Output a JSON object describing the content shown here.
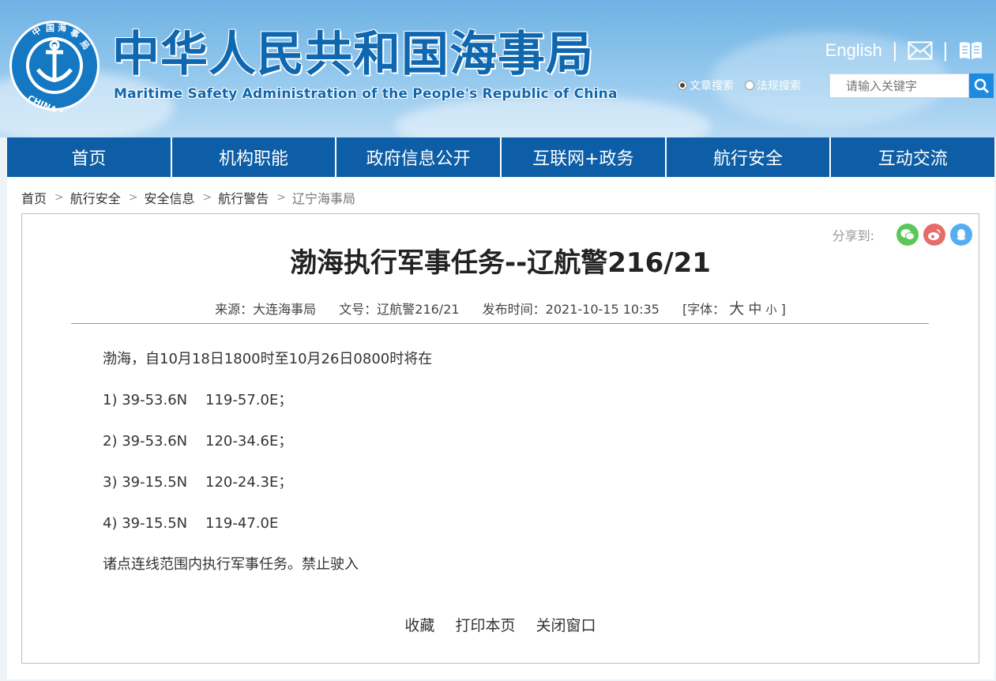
{
  "header": {
    "title": "中华人民共和国海事局",
    "subtitle": "Maritime Safety Administration of the People's Republic of China",
    "logo_text": "中国海事局 CHINA MSA",
    "english_link": "English",
    "search_options": [
      "文章搜索",
      "法规搜索"
    ],
    "search_selected": "文章搜索",
    "search_placeholder": "请输入关键字"
  },
  "nav": {
    "items": [
      "首页",
      "机构职能",
      "政府信息公开",
      "互联网+政务",
      "航行安全",
      "互动交流"
    ]
  },
  "breadcrumb": [
    "首页",
    "航行安全",
    "安全信息",
    "航行警告",
    "辽宁海事局"
  ],
  "share": {
    "label": "分享到:",
    "targets": [
      "wechat-icon",
      "weibo-icon",
      "qq-icon"
    ]
  },
  "article": {
    "title": "渤海执行军事任务--辽航警216/21",
    "source": "来源：大连海事局",
    "doc_no": "文号：辽航警216/21",
    "published": "发布时间：2021-10-15 10:35",
    "font_label": "[字体：",
    "font_big": "大",
    "font_mid": "中",
    "font_small": "小",
    "font_close": "]",
    "paragraphs": [
      "渤海，自10月18日1800时至10月26日0800时将在",
      "1) 39-53.6N    119-57.0E；",
      "2) 39-53.6N    120-34.6E；",
      "3) 39-15.5N    120-24.3E；",
      "4) 39-15.5N    119-47.0E",
      "诸点连线范围内执行军事任务。禁止驶入"
    ]
  },
  "actions": {
    "favorite": "收藏",
    "print": "打印本页",
    "close": "关闭窗口"
  },
  "colors": {
    "brand": "#0f67b0",
    "nav_bg": "#0d5ea6",
    "search_btn": "#1d8ae0"
  }
}
